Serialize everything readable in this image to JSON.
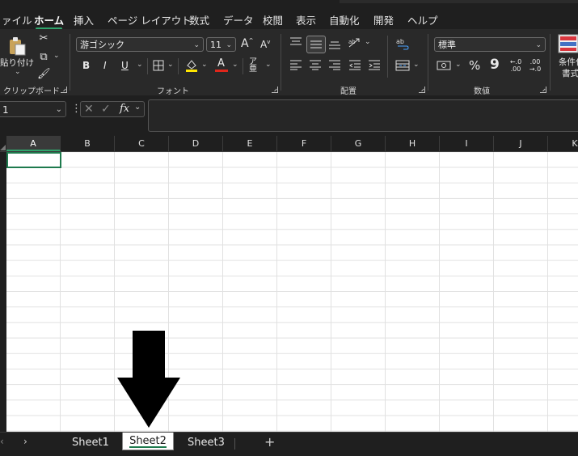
{
  "tabs": [
    {
      "label": "ァイル"
    },
    {
      "label": "ホーム"
    },
    {
      "label": "挿入"
    },
    {
      "label": "ページ レイアウト"
    },
    {
      "label": "数式"
    },
    {
      "label": "データ"
    },
    {
      "label": "校閲"
    },
    {
      "label": "表示"
    },
    {
      "label": "自動化"
    },
    {
      "label": "開発"
    },
    {
      "label": "ヘルプ"
    }
  ],
  "ribbon": {
    "clipboard": {
      "paste_label": "貼り付け",
      "group_label": "クリップボード"
    },
    "font": {
      "font_name": "游ゴシック",
      "font_size": "11",
      "bold": "B",
      "italic": "I",
      "underline": "U",
      "grow": "A",
      "shrink": "A",
      "font_color": "A",
      "group_label": "フォント"
    },
    "alignment": {
      "group_label": "配置"
    },
    "number": {
      "format": "標準",
      "percent": "%",
      "comma": "9",
      "group_label": "数値"
    },
    "styles": {
      "conditional_label_1": "条件付",
      "conditional_label_2": "書式"
    }
  },
  "formula_bar": {
    "name_box": "1",
    "fx": "fx",
    "formula": ""
  },
  "grid": {
    "columns": [
      "A",
      "B",
      "C",
      "D",
      "E",
      "F",
      "G",
      "H",
      "I",
      "J",
      "K"
    ],
    "selected_column": "A",
    "active_cell": "A1"
  },
  "sheets": [
    {
      "label": "Sheet1"
    },
    {
      "label": "Sheet2"
    },
    {
      "label": "Sheet3"
    }
  ],
  "active_sheet": "Sheet2",
  "colors": {
    "accent": "#1e7a4d",
    "arrow": "#000000",
    "background": "#1f1f1f",
    "ribbon": "#292929"
  }
}
